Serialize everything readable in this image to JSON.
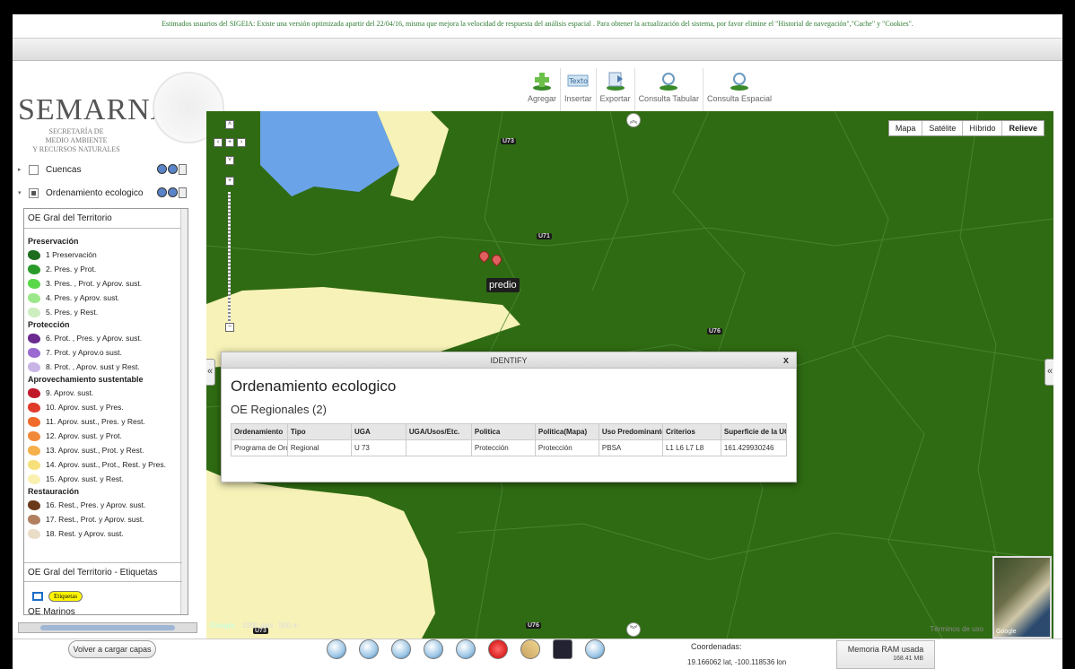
{
  "banner": {
    "notice": "Estimados usuarios del SIGEIA: Existe una versión optimizada apartir del 22/04/16, misma que mejora la velocidad de respuesta del análisis espacial . Para obtener la actualización del sistema, por favor elimine el \"Historial de navegación\",\"Cache\" y \"Cookies\"."
  },
  "logo": {
    "name": "SEMARNAT",
    "subtitle_1": "SECRETARÍA DE",
    "subtitle_2": "MEDIO AMBIENTE",
    "subtitle_3": "Y RECURSOS NATURALES"
  },
  "toolbar": {
    "agregar": "Agregar",
    "insertar": "Insertar",
    "insertar_icon_text": "Texto",
    "exportar": "Exportar",
    "consulta_tabular": "Consulta Tabular",
    "consulta_espacial": "Consulta Espacial"
  },
  "map": {
    "types": [
      "Mapa",
      "Satélite",
      "Híbrido",
      "Relieve"
    ],
    "active_type": "Relieve",
    "badges": [
      "U73",
      "U71",
      "U76",
      "U76",
      "U73"
    ],
    "marker_label": "predio",
    "scale_feet": "1000 pies",
    "scale_m": "500 m",
    "terms": "Términos de uso",
    "google": "Google"
  },
  "identify": {
    "window_title": "IDENTIFY",
    "close": "x",
    "heading": "Ordenamiento ecologico",
    "subheading": "OE Regionales (2)",
    "columns": [
      "Ordenamiento",
      "Tipo",
      "UGA",
      "UGA/Usos/Etc.",
      "Politica",
      "Politica(Mapa)",
      "Uso Predominante",
      "Criterios",
      "Superficie de la UGA"
    ],
    "rows": [
      [
        "Programa de Ordenamiento",
        "Regional",
        "U 73",
        "",
        "Protección",
        "Protección",
        "PBSA",
        "L1 L6 L7 L8",
        "161.429930246"
      ]
    ]
  },
  "layers": {
    "cuencas": "Cuencas",
    "ordenamiento": "Ordenamiento ecologico",
    "selected_sublayer": "OE Gral del Territorio",
    "sublayer_etiquetas": "OE Gral del Territorio - Etiquetas",
    "etiquetas_pill": "Etiquetas",
    "oe_marinos": "OE Marinos"
  },
  "legend": [
    {
      "heading": "Preservación",
      "items": [
        {
          "label": "1 Preservación",
          "color": "#1f6b1f"
        },
        {
          "label": "2. Pres. y Prot.",
          "color": "#2a9a2a"
        },
        {
          "label": "3. Pres. , Prot. y Aprov. sust.",
          "color": "#5ad84a"
        },
        {
          "label": "4. Pres. y Aprov. sust.",
          "color": "#9be88a"
        },
        {
          "label": "5. Pres. y Rest.",
          "color": "#cdeec0"
        }
      ]
    },
    {
      "heading": "Protección",
      "items": [
        {
          "label": "6. Prot. , Pres. y Aprov. sust.",
          "color": "#6a2a90"
        },
        {
          "label": "7. Prot. y Aprov.o sust.",
          "color": "#9a6ad0"
        },
        {
          "label": "8. Prot. , Aprov. sust y Rest.",
          "color": "#c9b4e6"
        }
      ]
    },
    {
      "heading": "Aprovechamiento sustentable",
      "items": [
        {
          "label": "9.  Aprov. sust.",
          "color": "#c01828"
        },
        {
          "label": "10. Aprov. sust. y Pres.",
          "color": "#e03a2a"
        },
        {
          "label": "11. Aprov. sust., Pres. y Rest.",
          "color": "#f06a2a"
        },
        {
          "label": "12. Aprov. sust. y Prot.",
          "color": "#f08a3a"
        },
        {
          "label": "13. Aprov. sust., Prot. y Rest.",
          "color": "#f5b04a"
        },
        {
          "label": "14. Aprov. sust., Prot., Rest. y Pres.",
          "color": "#f7e07a"
        },
        {
          "label": "15. Aprov. sust. y Rest.",
          "color": "#f9f0b0"
        }
      ]
    },
    {
      "heading": "Restauración",
      "items": [
        {
          "label": "16. Rest., Pres. y Aprov. sust.",
          "color": "#6a3a1a"
        },
        {
          "label": "17. Rest., Prot. y Aprov. sust.",
          "color": "#b08060"
        },
        {
          "label": "18. Rest. y Aprov. sust.",
          "color": "#eaddc8"
        }
      ]
    }
  ],
  "bottom": {
    "reload": "Volver a cargar capas",
    "coord_label": "Coordenadas:",
    "coord_value": "19.166062 lat, -100.118536 lon",
    "ram_label": "Memoria RAM usada",
    "ram_value": "168.41 MB"
  }
}
